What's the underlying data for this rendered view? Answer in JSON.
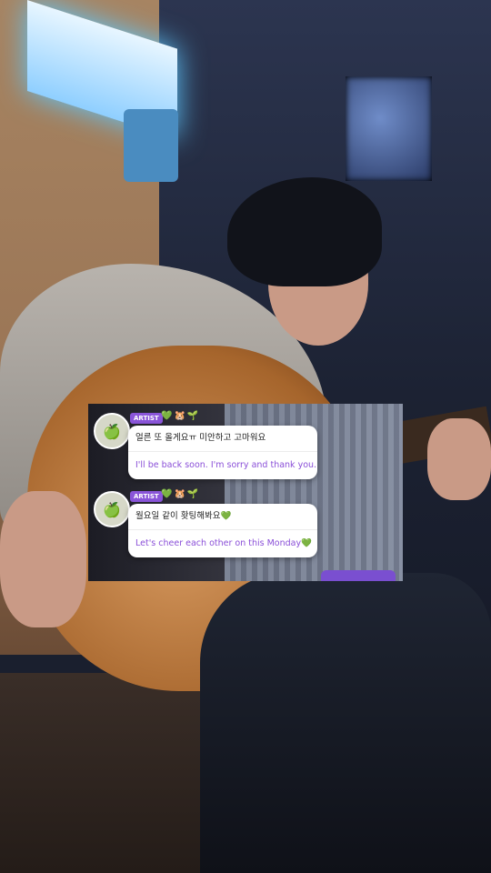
{
  "messages": [
    {
      "badge": "ARTIST",
      "emojis": "💚🐹🌱",
      "korean": "얼른 또 올게요ㅠ 미안하고 고마워요",
      "english": "I'll be back soon. I'm sorry and thank you."
    },
    {
      "badge": "ARTIST",
      "emojis": "💚🐹🌱",
      "korean": "월요일 같이 홧팅해봐요💚",
      "english": "Let's cheer each other on this Monday💚"
    }
  ],
  "icons": {
    "avatar": "apple-avatar-icon"
  },
  "colors": {
    "accent": "#8a55d9",
    "translation_text": "#8a4fd8"
  }
}
